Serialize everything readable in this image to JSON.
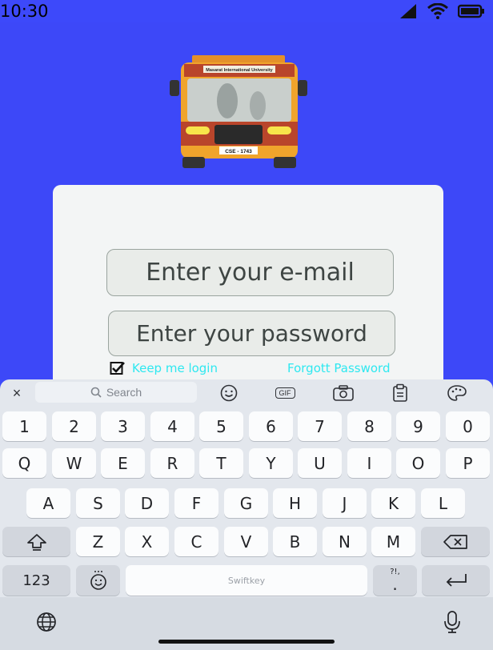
{
  "status": {
    "time": "10:30"
  },
  "bus": {
    "banner": "Masarat International University",
    "plate": "CSE - 1743"
  },
  "form": {
    "email_placeholder": "Enter your e-mail",
    "password_placeholder": "Enter your password",
    "keep_login": "Keep me login",
    "forgot_password": "Forgott Password"
  },
  "keyboard": {
    "close": "×",
    "search": "Search",
    "gif": "GIF",
    "numbers": [
      "1",
      "2",
      "3",
      "4",
      "5",
      "6",
      "7",
      "8",
      "9",
      "0"
    ],
    "row1": [
      "Q",
      "W",
      "E",
      "R",
      "T",
      "Y",
      "U",
      "I",
      "O",
      "P"
    ],
    "row2": [
      "A",
      "S",
      "D",
      "F",
      "G",
      "H",
      "J",
      "K",
      "L"
    ],
    "row3": [
      "Z",
      "X",
      "C",
      "V",
      "B",
      "N",
      "M"
    ],
    "num_toggle": "123",
    "space_brand": "Swiftkey",
    "punct": "?!,",
    "punct_dot": "."
  },
  "colors": {
    "app_bg": "#3d48f8",
    "link": "#2ee8f0"
  }
}
